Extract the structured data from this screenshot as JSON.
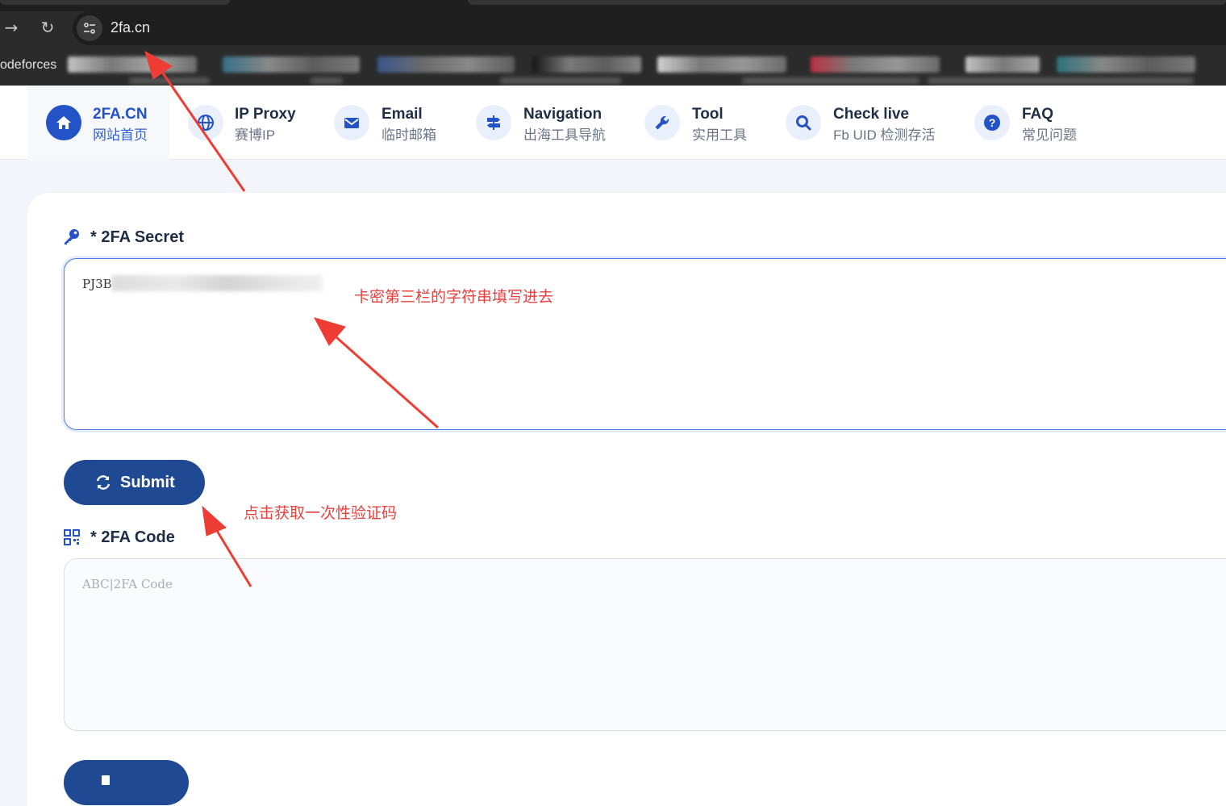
{
  "browser": {
    "url": "2fa.cn",
    "bookmark_visible_label": "odeforces",
    "icons": {
      "forward": "arrow-right-icon",
      "reload": "reload-icon",
      "site_info": "site-settings-icon"
    }
  },
  "header": {
    "nav": [
      {
        "title": "2FA.CN",
        "sub": "网站首页",
        "icon": "home-icon"
      },
      {
        "title": "IP Proxy",
        "sub": "赛博IP",
        "icon": "globe-icon"
      },
      {
        "title": "Email",
        "sub": "临时邮箱",
        "icon": "envelope-icon"
      },
      {
        "title": "Navigation",
        "sub": "出海工具导航",
        "icon": "signpost-icon"
      },
      {
        "title": "Tool",
        "sub": "实用工具",
        "icon": "wrench-icon"
      },
      {
        "title": "Check live",
        "sub": "Fb UID 检测存活",
        "icon": "search-icon"
      },
      {
        "title": "FAQ",
        "sub": "常见问题",
        "icon": "question-icon"
      }
    ],
    "active_color": "#2453c8"
  },
  "form": {
    "secret_label": "* 2FA Secret",
    "secret_value": "PJ3B",
    "submit_label": "Submit",
    "code_label": "* 2FA Code",
    "code_placeholder": "ABC|2FA Code",
    "button_color": "#1f4a93"
  },
  "annotations": {
    "secret_hint": "卡密第三栏的字符串填写进去",
    "submit_hint": "点击获取一次性验证码",
    "color": "#e8403c"
  }
}
